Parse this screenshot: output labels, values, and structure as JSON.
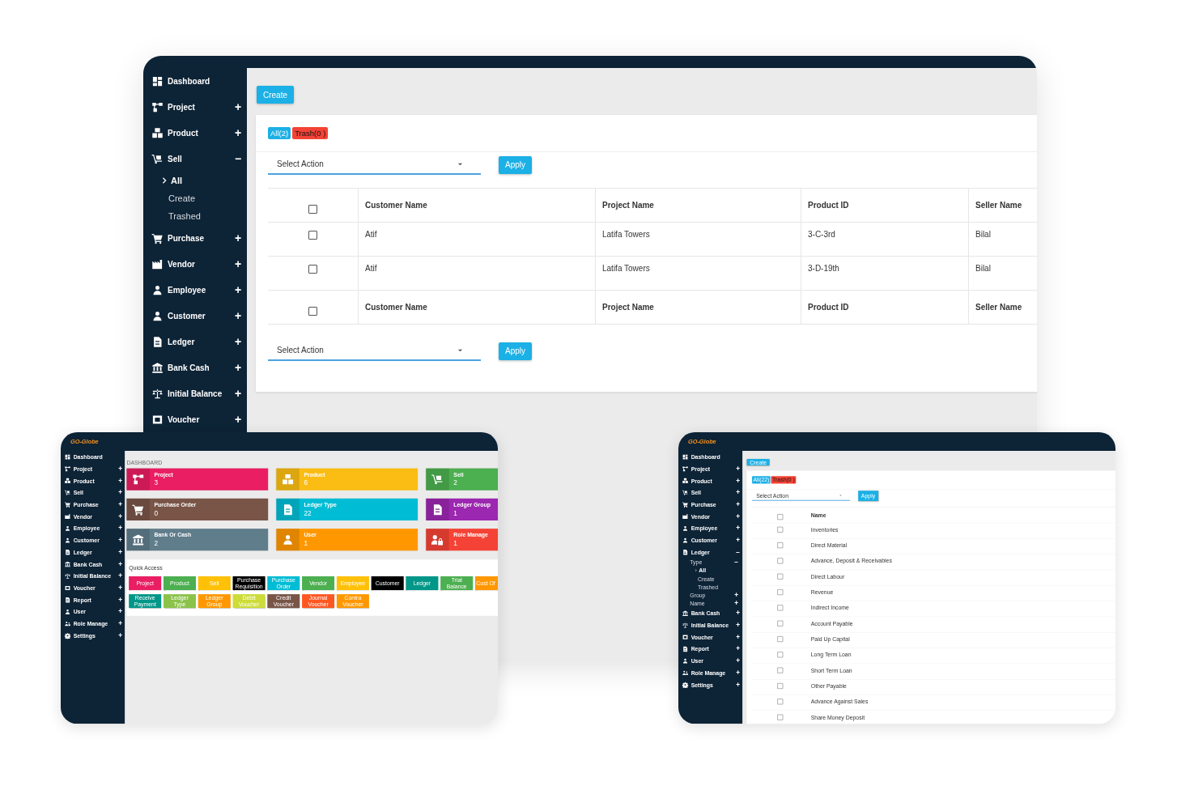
{
  "windows": [
    {
      "kind": "list",
      "sidebar": [
        {
          "label": "Dashboard",
          "kind": "dashboard"
        },
        {
          "label": "Project",
          "kind": "project",
          "toggle": "+"
        },
        {
          "label": "Product",
          "kind": "product",
          "toggle": "+"
        },
        {
          "label": "Sell",
          "kind": "sell",
          "toggle": "−",
          "children": [
            {
              "label": "All",
              "selected": true
            },
            {
              "label": "Create",
              "selected": false
            },
            {
              "label": "Trashed",
              "selected": false
            }
          ]
        },
        {
          "label": "Purchase",
          "kind": "purchase",
          "toggle": "+"
        },
        {
          "label": "Vendor",
          "kind": "vendor",
          "toggle": "+"
        },
        {
          "label": "Employee",
          "kind": "employee",
          "toggle": "+"
        },
        {
          "label": "Customer",
          "kind": "customer",
          "toggle": "+"
        },
        {
          "label": "Ledger",
          "kind": "ledger",
          "toggle": "+"
        },
        {
          "label": "Bank Cash",
          "kind": "bank",
          "toggle": "+"
        },
        {
          "label": "Initial Balance",
          "kind": "balance",
          "toggle": "+"
        },
        {
          "label": "Voucher",
          "kind": "voucher",
          "toggle": "+"
        }
      ],
      "create_button": "Create",
      "filters": [
        {
          "label": "All(2)",
          "kind": "all"
        },
        {
          "label": "Trash(0 )",
          "kind": "trash"
        }
      ],
      "bulk_actions": [
        {
          "placeholder": "Select Action",
          "button": "Apply"
        },
        {
          "placeholder": "Select Action",
          "button": "Apply"
        }
      ],
      "table": {
        "select_all_checked": false,
        "columns": [
          "Customer Name",
          "Project Name",
          "Product ID",
          "Seller Name"
        ],
        "rows": [
          {
            "checked": false,
            "cells": [
              "Atif",
              "Latifa Towers",
              "3-C-3rd",
              "Bilal"
            ]
          },
          {
            "checked": false,
            "cells": [
              "Atif",
              "Latifa Towers",
              "3-D-19th",
              "Bilal"
            ]
          }
        ],
        "footer_checked": false,
        "footer_columns": [
          "Customer Name",
          "Project Name",
          "Product ID",
          "Seller Name"
        ]
      }
    },
    {
      "kind": "dashboard",
      "logo": "GO-Globe",
      "sidebar": [
        {
          "label": "Dashboard",
          "kind": "dashboard"
        },
        {
          "label": "Project",
          "kind": "project",
          "toggle": "+"
        },
        {
          "label": "Product",
          "kind": "product",
          "toggle": "+"
        },
        {
          "label": "Sell",
          "kind": "sell",
          "toggle": "+"
        },
        {
          "label": "Purchase",
          "kind": "purchase",
          "toggle": "+"
        },
        {
          "label": "Vendor",
          "kind": "vendor",
          "toggle": "+"
        },
        {
          "label": "Employee",
          "kind": "employee",
          "toggle": "+"
        },
        {
          "label": "Customer",
          "kind": "customer",
          "toggle": "+"
        },
        {
          "label": "Ledger",
          "kind": "ledger",
          "toggle": "+"
        },
        {
          "label": "Bank Cash",
          "kind": "bank",
          "toggle": "+"
        },
        {
          "label": "Initial Balance",
          "kind": "balance",
          "toggle": "+"
        },
        {
          "label": "Voucher",
          "kind": "voucher",
          "toggle": "+"
        },
        {
          "label": "Report",
          "kind": "report",
          "toggle": "+"
        },
        {
          "label": "User",
          "kind": "user",
          "toggle": "+"
        },
        {
          "label": "Role Manage",
          "kind": "role",
          "toggle": "+"
        },
        {
          "label": "Settings",
          "kind": "settings",
          "toggle": "+"
        }
      ],
      "heading": "DASHBOARD",
      "cards": [
        {
          "label": "Project",
          "count": "3",
          "color": "#e91e63",
          "kind": "project"
        },
        {
          "label": "Product",
          "count": "6",
          "color": "#fbbd13",
          "kind": "product"
        },
        {
          "label": "Sell",
          "count": "2",
          "color": "#4caf50",
          "kind": "sell"
        },
        {
          "label": "Purchase Order",
          "count": "0",
          "color": "#795548",
          "kind": "purchase"
        },
        {
          "label": "Ledger Type",
          "count": "22",
          "color": "#00bcd4",
          "kind": "ledger"
        },
        {
          "label": "Ledger Group",
          "count": "1",
          "color": "#9c27b0",
          "kind": "ledger"
        },
        {
          "label": "Bank Or Cash",
          "count": "2",
          "color": "#607d8b",
          "kind": "bank"
        },
        {
          "label": "User",
          "count": "1",
          "color": "#ff9800",
          "kind": "user"
        },
        {
          "label": "Role Manage",
          "count": "1",
          "color": "#f44336",
          "kind": "role"
        }
      ],
      "quick_access": {
        "title": "Quick Access",
        "rows": [
          [
            {
              "label": "Project",
              "color": "#e91e63"
            },
            {
              "label": "Product",
              "color": "#4caf50"
            },
            {
              "label": "Sell",
              "color": "#ffc107"
            },
            {
              "label": "Purchase Requisition",
              "color": "#000000"
            },
            {
              "label": "Purchase Order",
              "color": "#00bcd4"
            },
            {
              "label": "Vendor",
              "color": "#4caf50"
            },
            {
              "label": "Employee",
              "color": "#ffc107"
            },
            {
              "label": "Customer",
              "color": "#000000"
            },
            {
              "label": "Ledger",
              "color": "#009688"
            },
            {
              "label": "Trial Balance",
              "color": "#4caf50"
            },
            {
              "label": "Cost Of",
              "color": "#ff9800"
            }
          ],
          [
            {
              "label": "Receive Payment",
              "color": "#009688"
            },
            {
              "label": "Ledger Type",
              "color": "#8bc34a"
            },
            {
              "label": "Ledger Group",
              "color": "#ff9800"
            },
            {
              "label": "Debit Voucher",
              "color": "#cddc39"
            },
            {
              "label": "Credit Voucher",
              "color": "#795548"
            },
            {
              "label": "Journal Voucher",
              "color": "#ff5722"
            },
            {
              "label": "Contra Voucher",
              "color": "#ff9800"
            }
          ]
        ]
      }
    },
    {
      "kind": "list",
      "logo": "GO-Globe",
      "sidebar": [
        {
          "label": "Dashboard",
          "kind": "dashboard"
        },
        {
          "label": "Project",
          "kind": "project",
          "toggle": "+"
        },
        {
          "label": "Product",
          "kind": "product",
          "toggle": "+"
        },
        {
          "label": "Sell",
          "kind": "sell",
          "toggle": "+"
        },
        {
          "label": "Purchase",
          "kind": "purchase",
          "toggle": "+"
        },
        {
          "label": "Vendor",
          "kind": "vendor",
          "toggle": "+"
        },
        {
          "label": "Employee",
          "kind": "employee",
          "toggle": "+"
        },
        {
          "label": "Customer",
          "kind": "customer",
          "toggle": "+"
        },
        {
          "label": "Ledger",
          "kind": "ledger",
          "toggle": "−",
          "children": [
            {
              "label": "Type",
              "selected": false,
              "toggle": "−",
              "children": [
                {
                  "label": "All",
                  "selected": true
                },
                {
                  "label": "Create",
                  "selected": false
                },
                {
                  "label": "Trashed",
                  "selected": false
                }
              ]
            },
            {
              "label": "Group",
              "selected": false,
              "toggle": "+"
            },
            {
              "label": "Name",
              "selected": false,
              "toggle": "+"
            }
          ]
        },
        {
          "label": "Bank Cash",
          "kind": "bank",
          "toggle": "+"
        },
        {
          "label": "Initial Balance",
          "kind": "balance",
          "toggle": "+"
        },
        {
          "label": "Voucher",
          "kind": "voucher",
          "toggle": "+"
        },
        {
          "label": "Report",
          "kind": "report",
          "toggle": "+"
        },
        {
          "label": "User",
          "kind": "user",
          "toggle": "+"
        },
        {
          "label": "Role Manage",
          "kind": "role",
          "toggle": "+"
        },
        {
          "label": "Settings",
          "kind": "settings",
          "toggle": "+"
        }
      ],
      "create_button": "Create",
      "filters": [
        {
          "label": "All(22)",
          "kind": "all"
        },
        {
          "label": "Trash(0 )",
          "kind": "trash"
        }
      ],
      "bulk_actions": [
        {
          "placeholder": "Select Action",
          "button": "Apply"
        }
      ],
      "table": {
        "select_all_checked": false,
        "columns": [
          "Name"
        ],
        "rows": [
          {
            "checked": false,
            "cells": [
              "Inventories"
            ]
          },
          {
            "checked": false,
            "cells": [
              "Direct Material"
            ]
          },
          {
            "checked": false,
            "cells": [
              "Advance, Deposit & Receivables"
            ]
          },
          {
            "checked": false,
            "cells": [
              "Direct Labour"
            ]
          },
          {
            "checked": false,
            "cells": [
              "Revenue"
            ]
          },
          {
            "checked": false,
            "cells": [
              "Indirect Income"
            ]
          },
          {
            "checked": false,
            "cells": [
              "Account Payable"
            ]
          },
          {
            "checked": false,
            "cells": [
              "Paid Up Capital"
            ]
          },
          {
            "checked": false,
            "cells": [
              "Long Term Loan"
            ]
          },
          {
            "checked": false,
            "cells": [
              "Short Term Loan"
            ]
          },
          {
            "checked": false,
            "cells": [
              "Other Payable"
            ]
          },
          {
            "checked": false,
            "cells": [
              "Advance Against Sales"
            ]
          },
          {
            "checked": false,
            "cells": [
              "Share Money Deposit"
            ]
          }
        ]
      }
    }
  ]
}
